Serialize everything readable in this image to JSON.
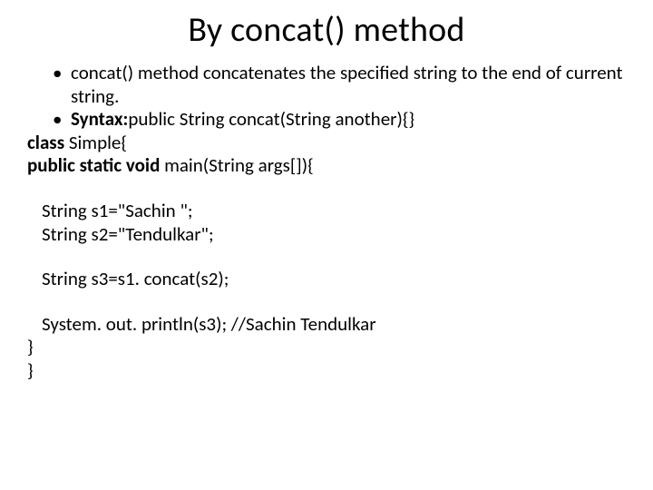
{
  "title": "By concat() method",
  "bullets": [
    {
      "plain": "concat() method concatenates the specified string to the end of current string."
    },
    {
      "bold": "Syntax:",
      "rest": "public String concat(String another){}"
    }
  ],
  "lines": {
    "classDecl_bold": "class ",
    "classDecl_rest": "Simple{",
    "mainDecl_bold": " public static void ",
    "mainDecl_rest": "main(String args[]){",
    "s1": "String s1=\"Sachin \";",
    "s2": "String s2=\"Tendulkar\";",
    "s3": "String s3=s1. concat(s2);",
    "println": "System. out. println(s3); //Sachin Tendulkar",
    "closeInner": "  }",
    "closeOuter": " }"
  }
}
